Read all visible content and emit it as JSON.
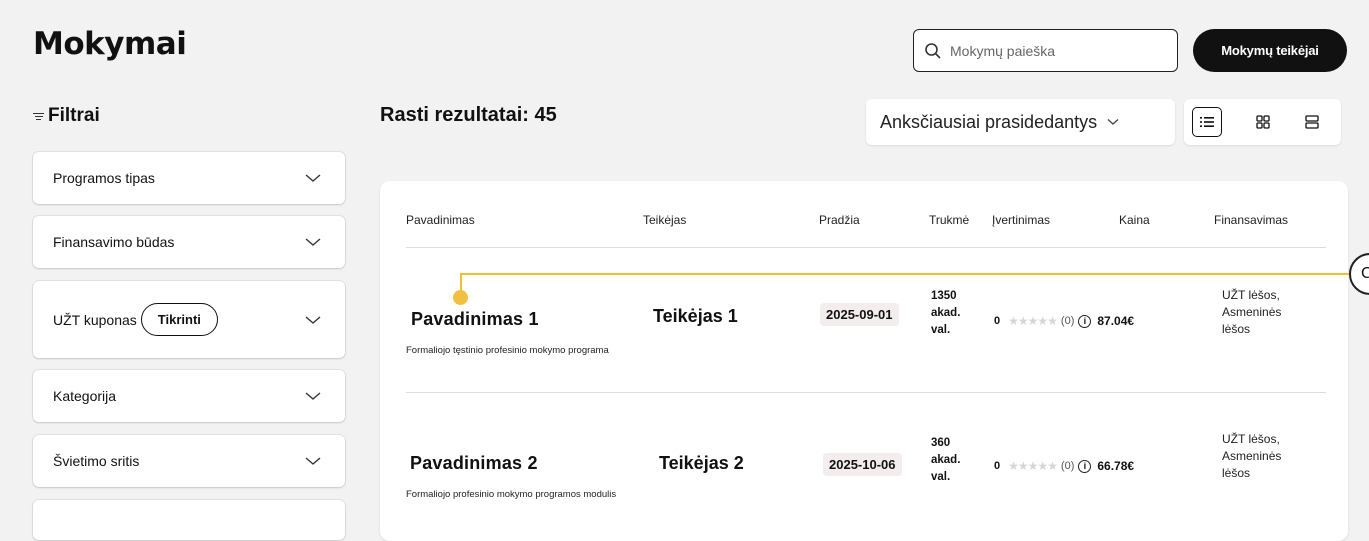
{
  "header": {
    "title": "Mokymai",
    "search_placeholder": "Mokymų paieška",
    "providers_button": "Mokymų teikėjai"
  },
  "filters": {
    "title": "Filtrai",
    "items": [
      {
        "label": "Programos tipas"
      },
      {
        "label": "Finansavimo būdas"
      },
      {
        "label": "UŽT kuponas",
        "button": "Tikrinti"
      },
      {
        "label": "Kategorija"
      },
      {
        "label": "Švietimo sritis"
      }
    ]
  },
  "results": {
    "label": "Rasti rezultatai: 45",
    "sort": "Anksčiausiai prasidedantys"
  },
  "table": {
    "headers": [
      "Pavadinimas",
      "Teikėjas",
      "Pradžia",
      "Trukmė",
      "Įvertinimas",
      "Kaina",
      "Finansavimas"
    ],
    "rows": [
      {
        "name": "Pavadinimas 1",
        "subtitle": "Formaliojo tęstinio profesinio mokymo programa",
        "provider": "Teikėjas 1",
        "start": "2025-09-01",
        "duration_1": "1350",
        "duration_2": "akad.",
        "duration_3": "val.",
        "rating": "0",
        "rating_stars": 0,
        "rating_count": "(0)",
        "price": "87.04€",
        "funding_1": "UŽT lėšos,",
        "funding_2": "Asmeninės",
        "funding_3": "lėšos"
      },
      {
        "name": "Pavadinimas 2",
        "subtitle": "Formaliojo profesinio mokymo programos modulis",
        "provider": "Teikėjas 2",
        "start": "2025-10-06",
        "duration_1": "360",
        "duration_2": "akad.",
        "duration_3": "val.",
        "rating": "0",
        "rating_stars": 0,
        "rating_count": "(0)",
        "price": "66.78€",
        "funding_1": "UŽT lėšos,",
        "funding_2": "Asmeninės",
        "funding_3": "lėšos"
      }
    ]
  },
  "tour": {
    "marker_label": "C"
  },
  "colors": {
    "accent": "#f0c030",
    "background": "#f2f2f2",
    "date_badge": "#f3eded"
  }
}
